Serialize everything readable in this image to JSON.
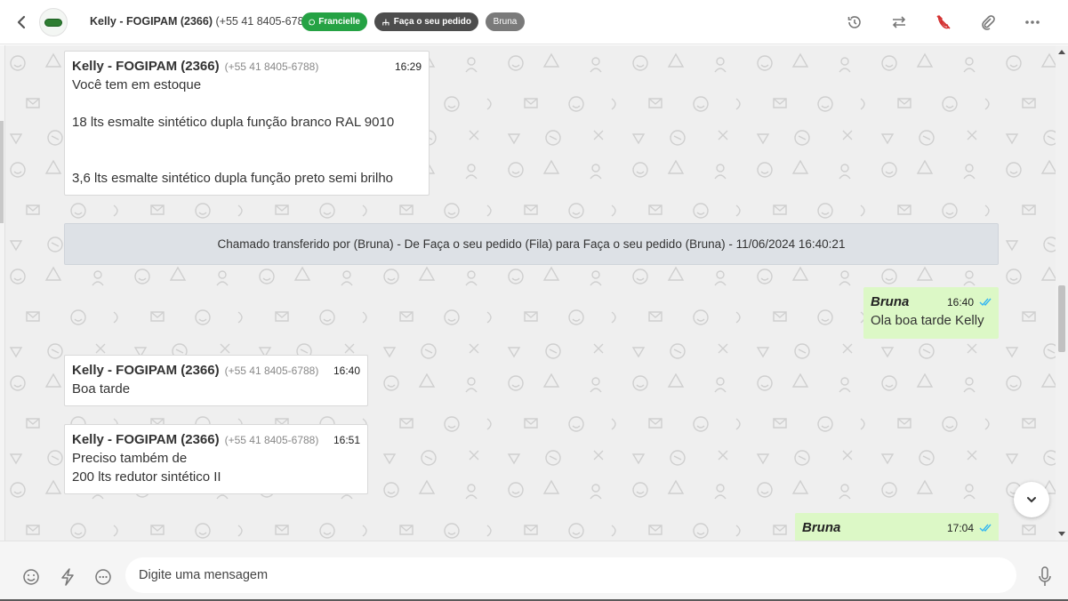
{
  "header": {
    "contact_name": "Kelly - FOGIPAM (2366)",
    "contact_phone": "(+55 41 8405-6788)",
    "tags": {
      "channel": "Francielle",
      "queue": "Faça o seu pedido",
      "agent": "Bruna"
    },
    "icons": [
      "back-icon",
      "history-icon",
      "transfer-icon",
      "end-call-icon",
      "attach-icon",
      "more-icon"
    ]
  },
  "messages": [
    {
      "type": "incoming",
      "sender": "Kelly - FOGIPAM (2366)",
      "phone": "(+55 41 8405-6788)",
      "time": "16:29",
      "text": "Você tem em estoque\n\n18 lts esmalte sintético dupla função branco RAL 9010\n\n\n3,6 lts esmalte sintético dupla função preto semi brilho"
    },
    {
      "type": "system",
      "text": "Chamado transferido por (Bruna) - De Faça o seu pedido (Fila) para Faça o seu pedido (Bruna) - 11/06/2024 16:40:21"
    },
    {
      "type": "outgoing",
      "sender": "Bruna",
      "time": "16:40",
      "text": "Ola boa tarde Kelly"
    },
    {
      "type": "incoming",
      "sender": "Kelly - FOGIPAM (2366)",
      "phone": "(+55 41 8405-6788)",
      "time": "16:40",
      "text": "Boa tarde"
    },
    {
      "type": "incoming",
      "sender": "Kelly - FOGIPAM (2366)",
      "phone": "(+55 41 8405-6788)",
      "time": "16:51",
      "text": "Preciso também de\n200 lts redutor sintético II"
    },
    {
      "type": "outgoing",
      "sender": "Bruna",
      "time": "17:04",
      "text": ""
    }
  ],
  "composer": {
    "placeholder": "Digite uma mensagem",
    "icons": [
      "emoji-icon",
      "quick-reply-icon",
      "more-options-icon",
      "microphone-icon"
    ]
  },
  "colors": {
    "incoming_bg": "#ffffff",
    "outgoing_bg": "#dcf8c6",
    "system_bg": "#dde1e6",
    "tag_green": "#25a244",
    "tag_dark": "#4d4d4d",
    "tag_gray": "#7a7a7a",
    "end_call_red": "#d32f2f",
    "read_check_blue": "#34b7f1"
  }
}
